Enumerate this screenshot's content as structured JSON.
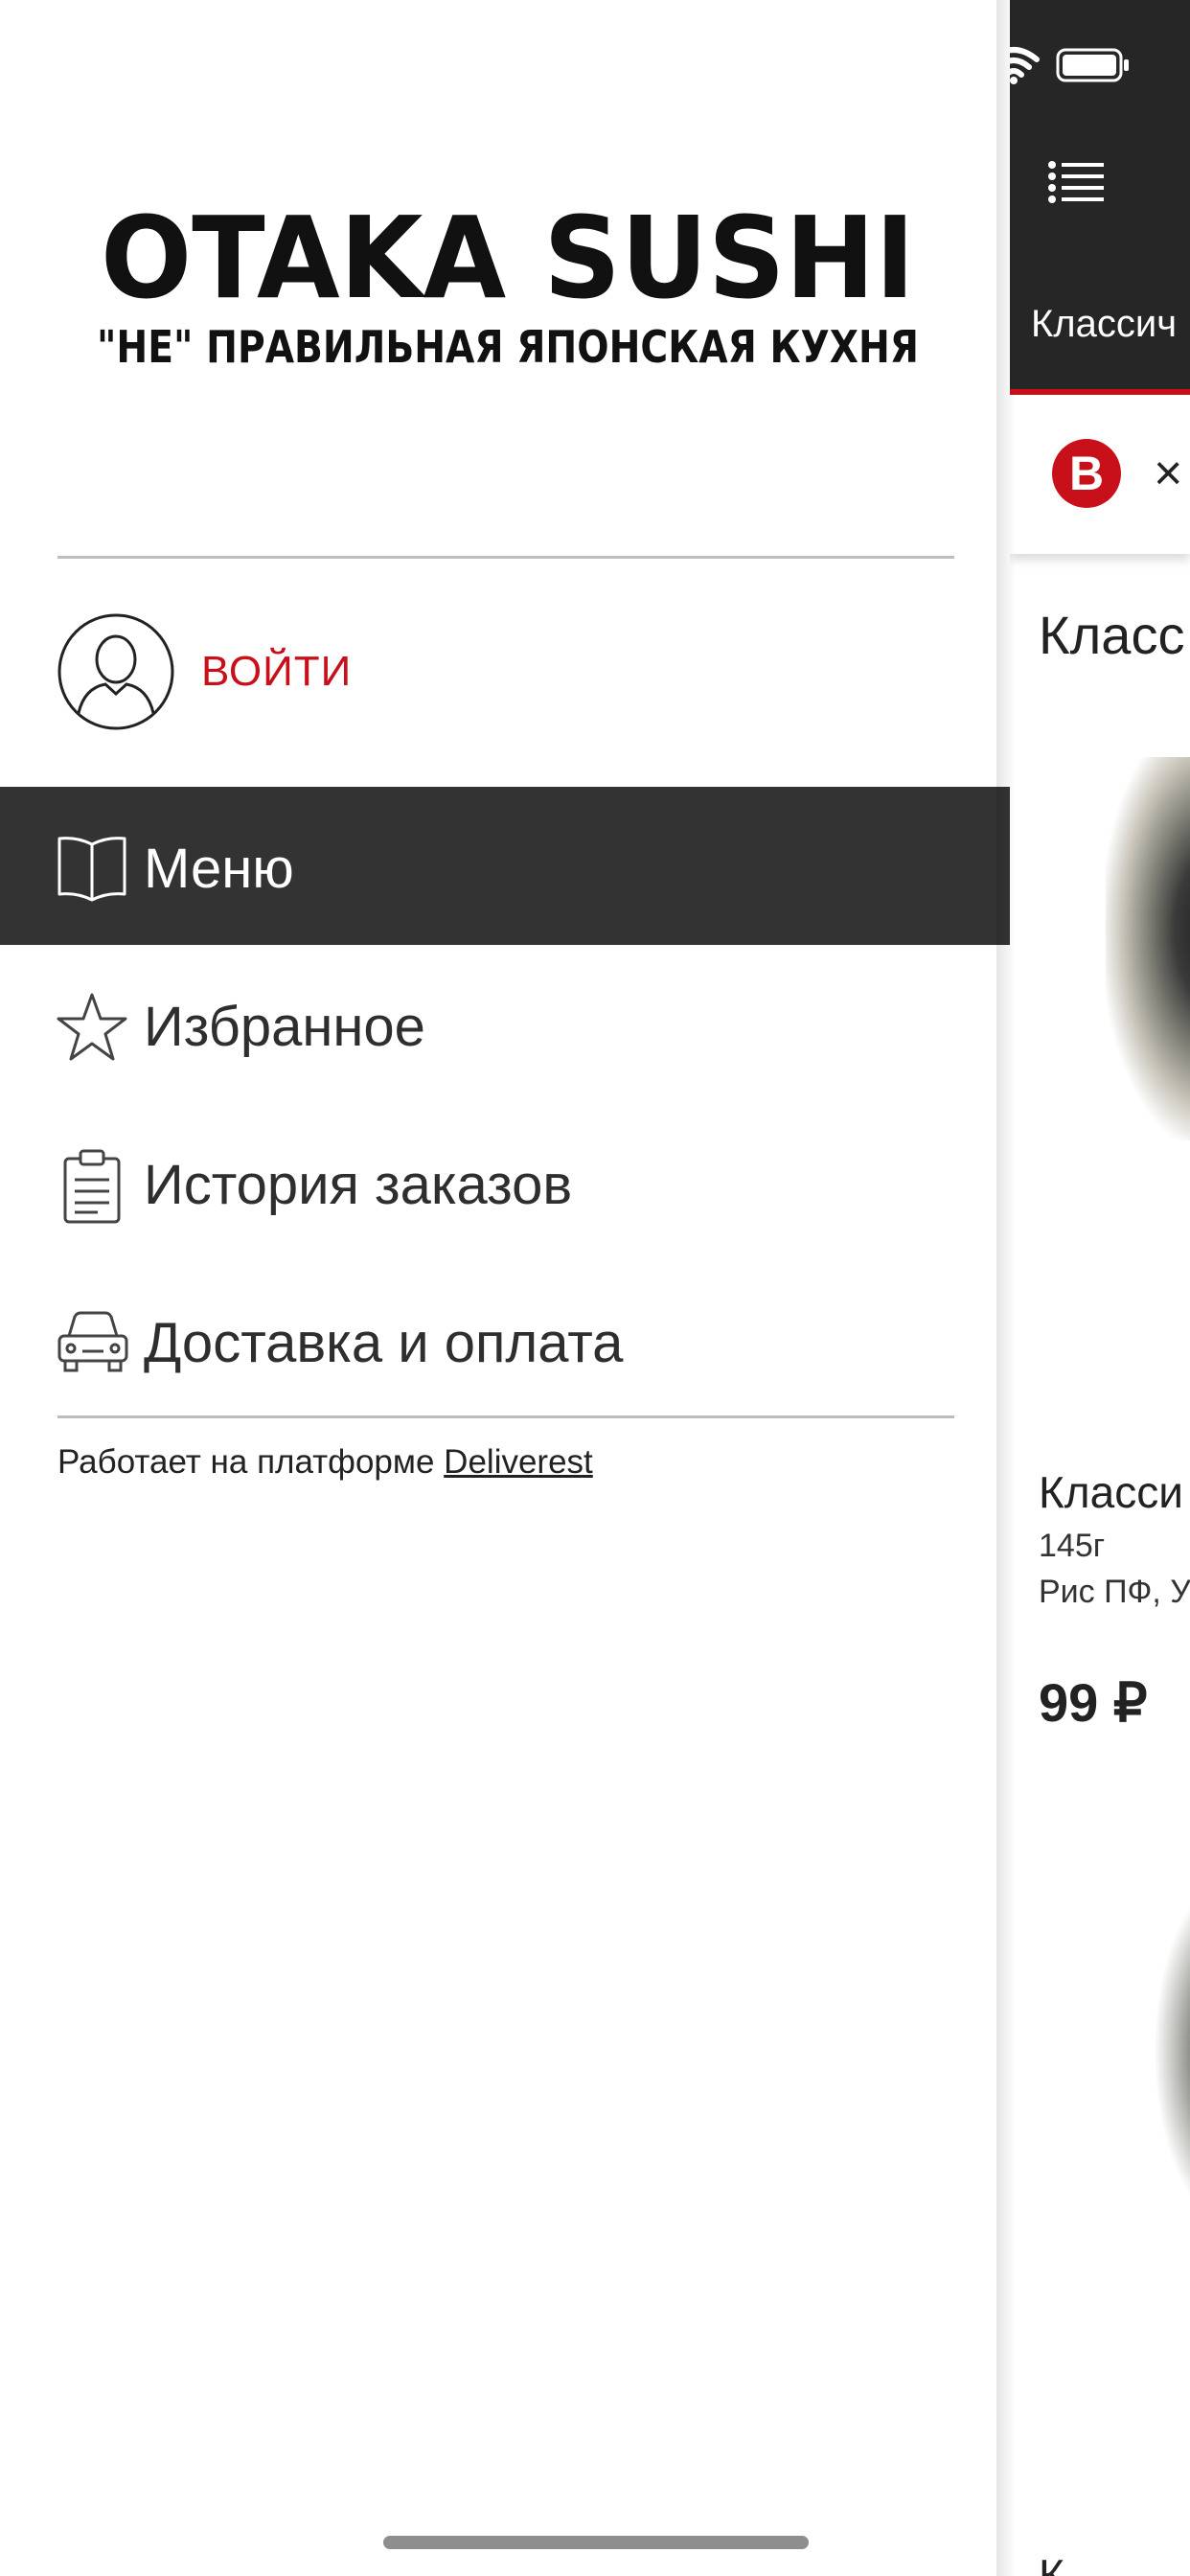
{
  "colors": {
    "accent": "#c8101a",
    "header_bg": "#262626",
    "active_item_bg": "#333333"
  },
  "logo": {
    "title": "OTAKA SUSHI",
    "subtitle": "\"НЕ\" ПРАВИЛЬНАЯ ЯПОНСКАЯ КУХНЯ"
  },
  "auth": {
    "login_label": "ВОЙТИ",
    "avatar_icon": "user-avatar-icon"
  },
  "drawer": {
    "items": [
      {
        "label": "Меню",
        "icon": "book-icon",
        "active": true
      },
      {
        "label": "Избранное",
        "icon": "star-icon",
        "active": false
      },
      {
        "label": "История заказов",
        "icon": "clipboard-icon",
        "active": false
      },
      {
        "label": "Доставка и оплата",
        "icon": "car-icon",
        "active": false
      }
    ],
    "powered_by_prefix": "Работает на платформе",
    "powered_by_link": "Deliverest"
  },
  "main": {
    "header_icon": "list-icon",
    "category_tab": "Классич",
    "filter_badge": "B",
    "filter_close": "×",
    "section_title": "Класс",
    "product": {
      "name": "Класси",
      "weight": "145г",
      "description": "Рис ПФ, У",
      "price": "99 ₽"
    },
    "next_product_name": "К"
  }
}
